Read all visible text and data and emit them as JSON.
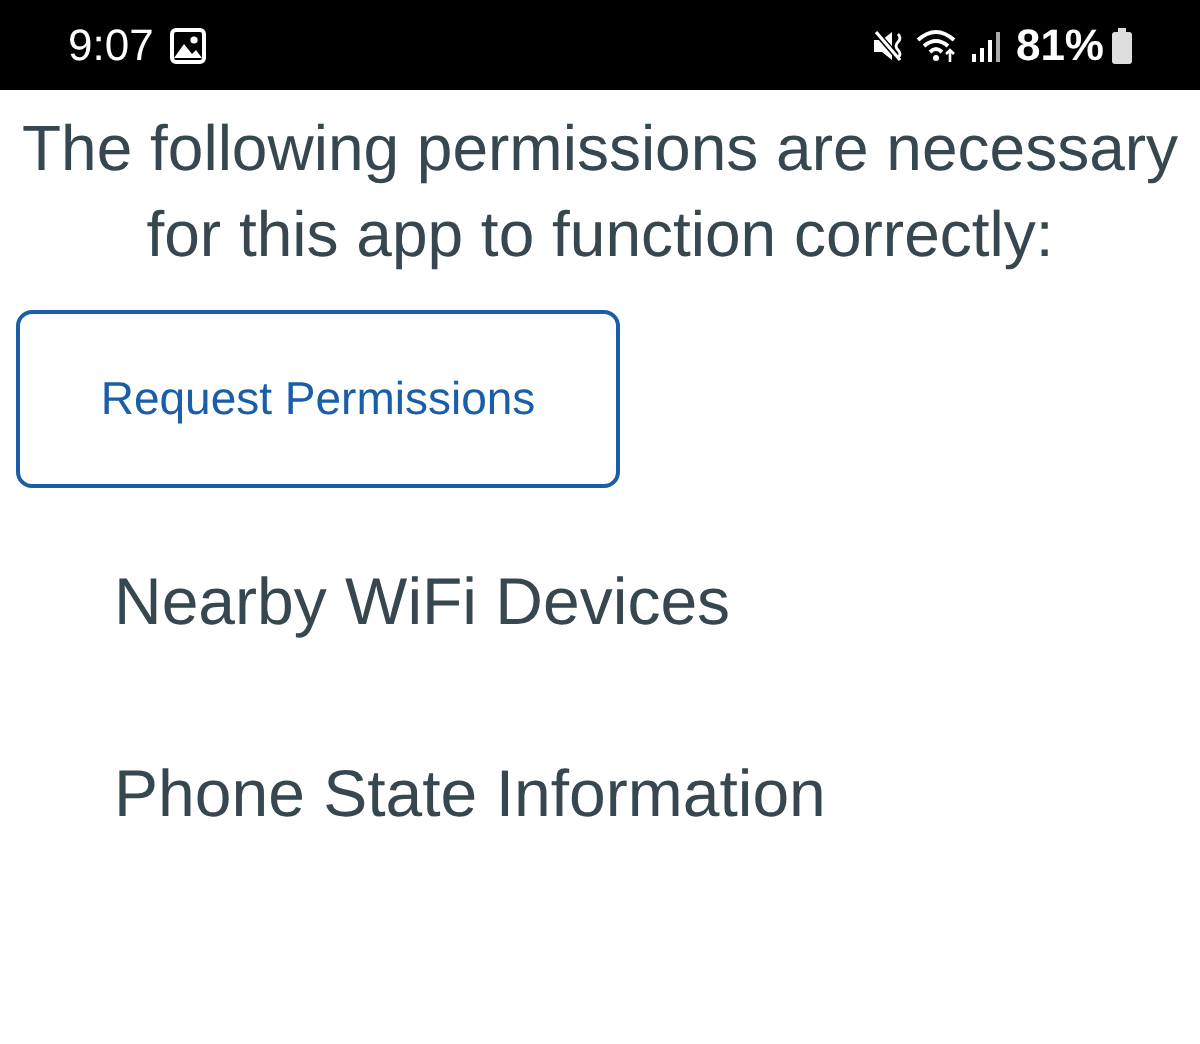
{
  "status_bar": {
    "time": "9:07",
    "battery": "81%"
  },
  "heading": "The following permissions are necessary for this app to function correctly:",
  "request_button": {
    "label": "Request Permissions"
  },
  "permissions": [
    {
      "label": "Nearby WiFi Devices"
    },
    {
      "label": "Phone State Information"
    }
  ]
}
